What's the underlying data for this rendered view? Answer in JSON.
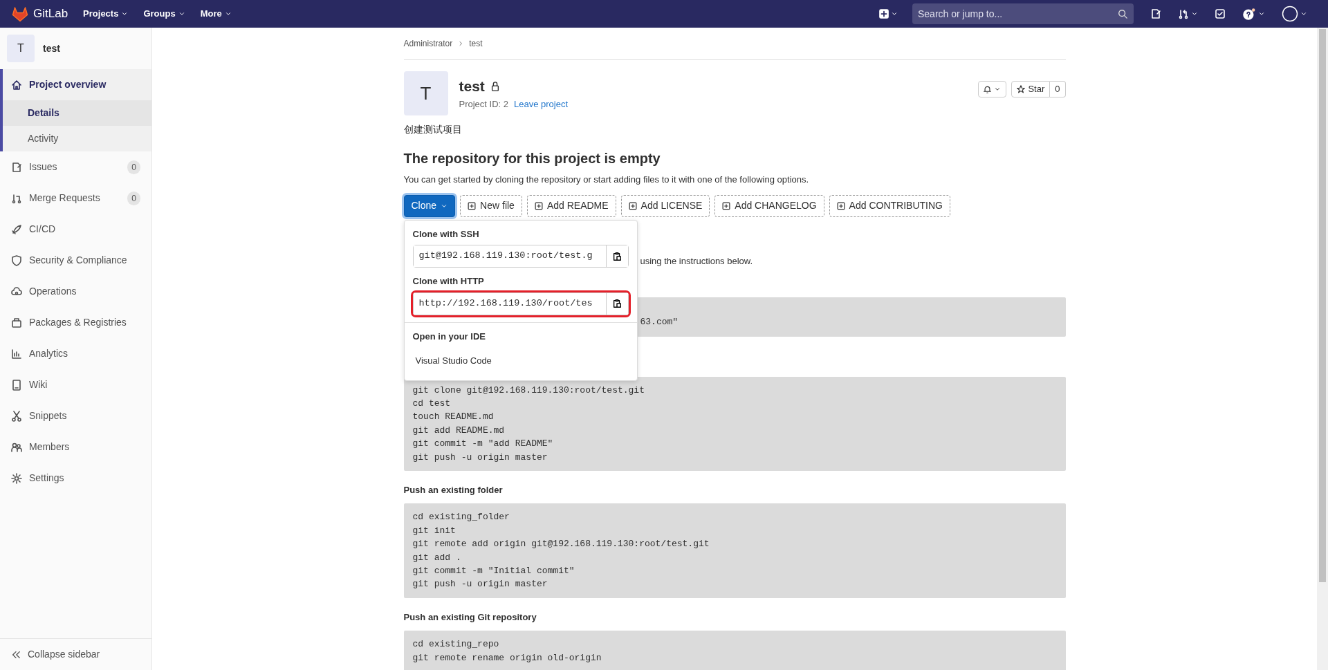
{
  "top_nav": {
    "brand": "GitLab",
    "menus": [
      "Projects",
      "Groups",
      "More"
    ],
    "search": {
      "placeholder": "Search or jump to..."
    }
  },
  "sidebar": {
    "project": {
      "avatar": "T",
      "name": "test"
    },
    "items": [
      {
        "label": "Project overview",
        "selected": true,
        "children": [
          {
            "label": "Details",
            "selected": true
          },
          {
            "label": "Activity",
            "selected": false
          }
        ]
      },
      {
        "label": "Issues",
        "selected": false,
        "count": "0"
      },
      {
        "label": "Merge Requests",
        "selected": false,
        "count": "0"
      },
      {
        "label": "CI/CD",
        "selected": false
      },
      {
        "label": "Security & Compliance",
        "selected": false
      },
      {
        "label": "Operations",
        "selected": false
      },
      {
        "label": "Packages & Registries",
        "selected": false
      },
      {
        "label": "Analytics",
        "selected": false
      },
      {
        "label": "Wiki",
        "selected": false
      },
      {
        "label": "Snippets",
        "selected": false
      },
      {
        "label": "Members",
        "selected": false
      },
      {
        "label": "Settings",
        "selected": false
      }
    ],
    "collapse": "Collapse sidebar"
  },
  "breadcrumb": [
    "Administrator",
    "test"
  ],
  "project": {
    "avatar": "T",
    "name": "test",
    "project_id": "Project ID: 2",
    "leave": "Leave project",
    "description": "创建测试项目",
    "star": {
      "label": "Star",
      "count": "0"
    }
  },
  "empty": {
    "heading": "The repository for this project is empty",
    "text": "You can get started by cloning the repository or start adding files to it with one of the following options."
  },
  "actions": [
    {
      "label": "Clone",
      "kind": "dropdown"
    },
    {
      "label": "New file",
      "kind": "add"
    },
    {
      "label": "Add README",
      "kind": "add"
    },
    {
      "label": "Add LICENSE",
      "kind": "add"
    },
    {
      "label": "Add CHANGELOG",
      "kind": "add"
    },
    {
      "label": "Add CONTRIBUTING",
      "kind": "add"
    }
  ],
  "clone_menu": {
    "sections": [
      {
        "title": "Clone with SSH",
        "value": "git@192.168.119.130:root/test.g",
        "highlighted": false
      },
      {
        "title": "Clone with HTTP",
        "value": "http://192.168.119.130/root/tes",
        "highlighted": true
      }
    ],
    "ide_title": "Open in your IDE",
    "ide_items": [
      "Visual Studio Code"
    ]
  },
  "instructions_fragment": "using the instructions below.",
  "code_fragment": "63.com\"",
  "code_sections": [
    {
      "lines": [
        "git clone git@192.168.119.130:root/test.git",
        "cd test",
        "touch README.md",
        "git add README.md",
        "git commit -m \"add README\"",
        "git push -u origin master"
      ]
    },
    {
      "heading": "Push an existing folder",
      "lines": [
        "cd existing_folder",
        "git init",
        "git remote add origin git@192.168.119.130:root/test.git",
        "git add .",
        "git commit -m \"Initial commit\"",
        "git push -u origin master"
      ]
    },
    {
      "heading": "Push an existing Git repository",
      "lines": [
        "cd existing_repo",
        "git remote rename origin old-origin"
      ]
    }
  ]
}
